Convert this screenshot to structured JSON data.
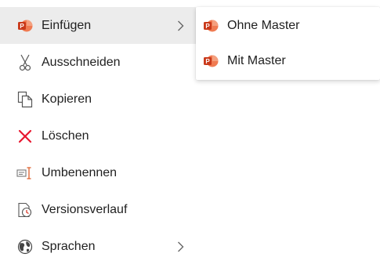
{
  "menu": {
    "items": [
      {
        "label": "Einfügen",
        "icon": "powerpoint-icon",
        "has_submenu": true,
        "active": true
      },
      {
        "label": "Ausschneiden",
        "icon": "scissors-icon",
        "has_submenu": false
      },
      {
        "label": "Kopieren",
        "icon": "copy-icon",
        "has_submenu": false
      },
      {
        "label": "Löschen",
        "icon": "delete-x-icon",
        "has_submenu": false
      },
      {
        "label": "Umbenennen",
        "icon": "rename-icon",
        "has_submenu": false
      },
      {
        "label": "Versionsverlauf",
        "icon": "version-history-icon",
        "has_submenu": false
      },
      {
        "label": "Sprachen",
        "icon": "globe-icon",
        "has_submenu": true
      }
    ]
  },
  "submenu": {
    "items": [
      {
        "label": "Ohne Master",
        "icon": "powerpoint-icon"
      },
      {
        "label": "Mit Master",
        "icon": "powerpoint-icon"
      }
    ]
  },
  "colors": {
    "powerpoint_orange": "#e9522b",
    "delete_red": "#e8172f",
    "active_bg": "#ececec",
    "text": "#1f1f1f"
  }
}
